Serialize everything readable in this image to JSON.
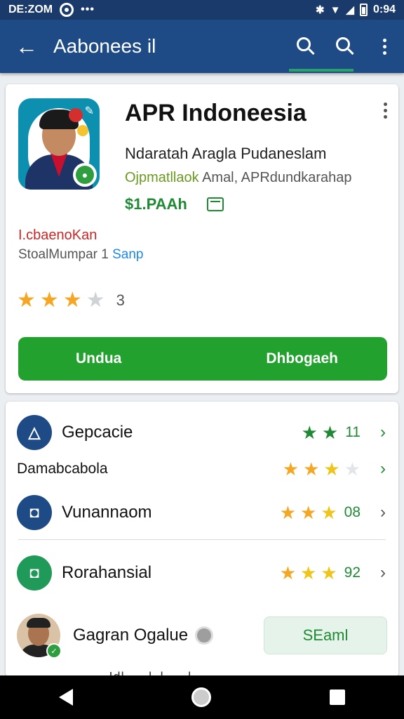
{
  "status_bar": {
    "time": "DE:ZOM",
    "dots": "•••",
    "bluetooth": "ʙ",
    "clock_right": "0:94"
  },
  "app_bar": {
    "title": "Aabonees il",
    "back": "←"
  },
  "app": {
    "name": "APR Indoneesia",
    "developer": "Ndaratah Aragla Pudaneslam",
    "category_accent": "Ojpmatllaok",
    "category_rest": " Amal, APRdundkarahap",
    "price": "$1.PAAh",
    "ad_label": "I.cbaenoKan",
    "ad_sub_text": "StoalMumpar 1 ",
    "ad_sub_link": "Sanp",
    "stars": [
      "★",
      "★",
      "★",
      "★"
    ],
    "rating_count": "3",
    "install_left": "Undua",
    "install_right": "Dhbogaeh"
  },
  "list": [
    {
      "label": "Gepcacie",
      "value": "11"
    },
    {
      "label": "Damabcabola",
      "value": ""
    },
    {
      "label": "Vunannaom",
      "value": "08"
    },
    {
      "label": "Rorahansial",
      "value": "92"
    }
  ],
  "reviewer": {
    "name": "Gagran Ogalue",
    "button": "SEaml",
    "cut_text": "~~~~~Idl~~~l~l~~~l~"
  },
  "icons": {
    "chevron": "›",
    "edit": "✎",
    "chat": "●"
  },
  "colors": {
    "app_bar": "#1e4a85",
    "install": "#22a12f",
    "star": "#f5a623",
    "price": "#1f8a33"
  }
}
